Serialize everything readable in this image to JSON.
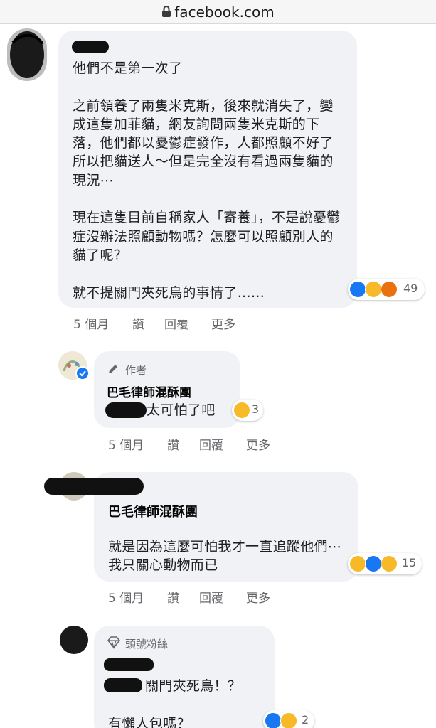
{
  "browser": {
    "url": "facebook.com"
  },
  "comments": [
    {
      "author": "",
      "text": "他們不是第一次了\n\n之前領養了兩隻米克斯，後來就消失了，變成這隻加菲貓，網友詢問兩隻米克斯的下落，他們都以憂鬱症發作，人都照顧不好了所以把貓送人～但是完全沒有看過兩隻貓的現況⋯\n\n現在這隻目前自稱家人「寄養」，不是說憂鬱症沒辦法照顧動物嗎？怎麼可以照顧別人的貓了呢？\n\n就不提關門夾死鳥的事情了……",
      "meta": {
        "time": "5 個月",
        "like": "讚",
        "reply": "回覆",
        "more": "更多"
      },
      "reactions": {
        "icons": [
          "like-icon",
          "wow-icon",
          "angry-icon"
        ],
        "count": "49"
      }
    },
    {
      "badge": "作者",
      "author": "巴毛律師混酥團",
      "text": "太可怕了吧",
      "meta": {
        "time": "5 個月",
        "like": "讚",
        "reply": "回覆",
        "more": "更多"
      },
      "reactions": {
        "icons": [
          "sad-icon"
        ],
        "count": "3"
      }
    },
    {
      "author": "",
      "mention": "巴毛律師混酥團",
      "text": "就是因為這麼可怕我才一直追蹤他們⋯我只關心動物而已",
      "meta": {
        "time": "5 個月",
        "like": "讚",
        "reply": "回覆",
        "more": "更多"
      },
      "reactions": {
        "icons": [
          "sad-icon",
          "like-icon",
          "wow-icon"
        ],
        "count": "15"
      }
    },
    {
      "badge": "頭號粉絲",
      "author": "",
      "text": "關門夾死鳥！？\n\n有懶人包嗎？",
      "reactions": {
        "icons": [
          "like-icon",
          "wow-icon"
        ],
        "count": "2"
      }
    }
  ],
  "colors": {
    "like": "#1877f2",
    "wow": "#f7b928",
    "angry": "#e9710f",
    "bubble": "#f0f2f5",
    "meta": "#65676b"
  }
}
